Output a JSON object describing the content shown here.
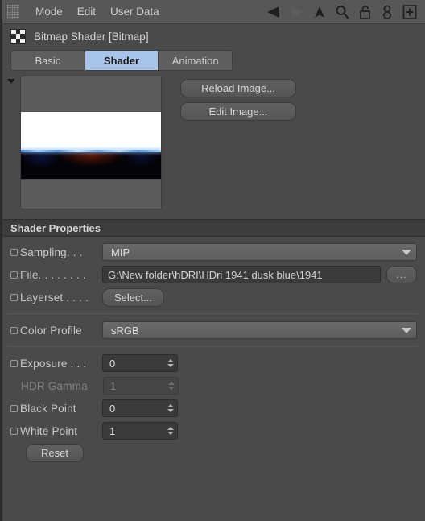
{
  "menubar": {
    "grip_icon": "grip-dots-icon",
    "items": [
      {
        "label": "Mode"
      },
      {
        "label": "Edit"
      },
      {
        "label": "User Data"
      }
    ],
    "tools": [
      {
        "icon": "back-arrow-icon",
        "enabled": true
      },
      {
        "icon": "forward-arrow-icon",
        "enabled": false
      },
      {
        "icon": "up-arrow-icon",
        "enabled": true
      },
      {
        "icon": "search-icon",
        "enabled": true
      },
      {
        "icon": "unlock-padlock-icon",
        "enabled": true
      },
      {
        "icon": "link-chain-icon",
        "enabled": true
      },
      {
        "icon": "new-panel-plus-icon",
        "enabled": true
      }
    ]
  },
  "object": {
    "icon": "bitmap-checker-icon",
    "title": "Bitmap Shader [Bitmap]"
  },
  "tabs": [
    {
      "label": "Basic",
      "active": false
    },
    {
      "label": "Shader",
      "active": true
    },
    {
      "label": "Animation",
      "active": false
    }
  ],
  "preview": {
    "collapse_icon": "triangle-down-icon",
    "image_alt": "hdri-sky-preview",
    "buttons": [
      {
        "label": "Reload Image..."
      },
      {
        "label": "Edit Image..."
      }
    ]
  },
  "shader_properties": {
    "section_title": "Shader Properties",
    "sampling": {
      "label": "Sampling. . .",
      "value": "MIP",
      "chevron_icon": "chevron-down-icon"
    },
    "file": {
      "label": "File. . . . . . . .",
      "value": "G:\\New folder\\hDRI\\HDri 1941 dusk blue\\1941",
      "browse_label": "..."
    },
    "layerset": {
      "label": "Layerset . . . .",
      "button_label": "Select..."
    },
    "color_profile": {
      "label": "Color Profile",
      "value": "sRGB",
      "chevron_icon": "chevron-down-icon"
    },
    "exposure": {
      "label": "Exposure . . .",
      "value": "0"
    },
    "hdr_gamma": {
      "label": "HDR Gamma",
      "value": "1",
      "disabled": true
    },
    "black_point": {
      "label": "Black Point",
      "value": "0"
    },
    "white_point": {
      "label": "White Point",
      "value": "1"
    },
    "reset": {
      "label": "Reset"
    }
  },
  "colors": {
    "panel_bg": "#4a4a4a",
    "menubar_bg": "#575757",
    "section_header_bg": "#3c3c3c",
    "tab_active_bg": "#a8c4e8",
    "field_bg": "#3a3a3a",
    "text": "#c9c9c9"
  }
}
